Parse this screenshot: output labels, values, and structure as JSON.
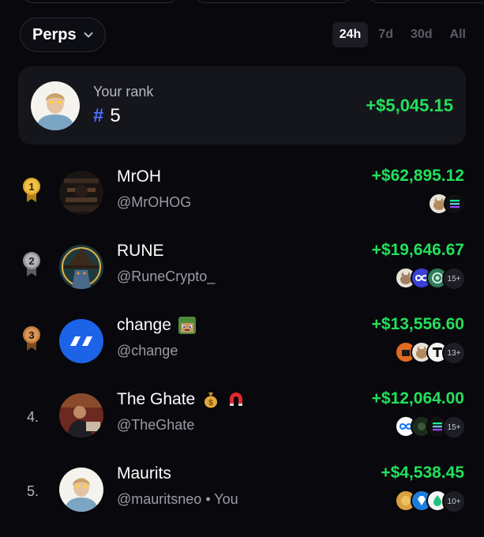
{
  "filters": {
    "market_label": "Perps",
    "periods": [
      "24h",
      "7d",
      "30d",
      "All"
    ],
    "active_period": "24h"
  },
  "your_rank": {
    "label": "Your rank",
    "hash": "#",
    "rank": "5",
    "pnl": "+$5,045.15"
  },
  "leaderboard": [
    {
      "rank": "1",
      "name": "MrOH",
      "handle": "@MrOHOG",
      "pnl": "+$62,895.12",
      "more": ""
    },
    {
      "rank": "2",
      "name": "RUNE",
      "handle": "@RuneCrypto_",
      "pnl": "+$19,646.67",
      "more": "15+"
    },
    {
      "rank": "3",
      "name": "change",
      "handle": "@change",
      "pnl": "+$13,556.60",
      "more": "13+"
    },
    {
      "rank": "4.",
      "name": "The Ghate",
      "handle": "@TheGhate",
      "pnl": "+$12,064.00",
      "more": "15+"
    },
    {
      "rank": "5.",
      "name": "Maurits",
      "handle": "@mauritsneo • You",
      "pnl": "+$4,538.45",
      "more": "10+"
    }
  ],
  "colors": {
    "background": "#08080d",
    "card": "#15151c",
    "profit_green": "#23e05a",
    "hash_blue": "#4f6fff",
    "gold": "#e0a82a",
    "silver": "#8e8e96",
    "bronze": "#c07a3a"
  },
  "icons": {
    "market_dropdown": "chevron-down-icon",
    "rank_1": "gold-medal-icon",
    "rank_2": "silver-medal-icon",
    "rank_3": "bronze-medal-icon",
    "change_emoji": "minecraft-face-emoji",
    "ghate_emojis": [
      "money-bag-emoji",
      "magnet-emoji"
    ]
  }
}
